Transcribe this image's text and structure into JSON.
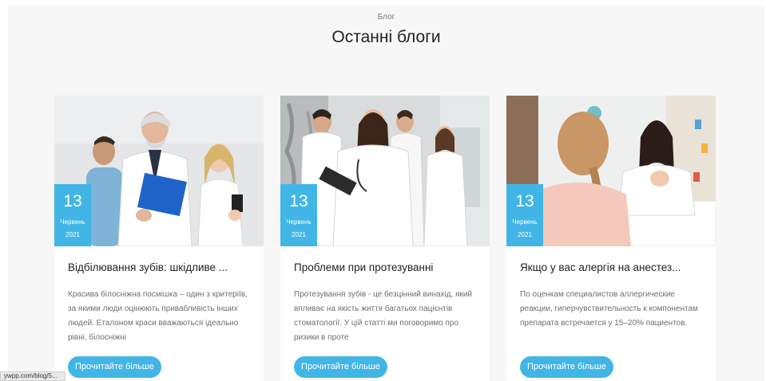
{
  "section": {
    "eyebrow": "Блог",
    "heading": "Останні блоги"
  },
  "posts": [
    {
      "day": "13",
      "month": "Червень",
      "year": "2021",
      "title": "Відбілювання зубів: шкідливе ...",
      "excerpt": "Красива білосніжна посмішка – один з критеріїв, за якими люди оцінюють привабливість інших людей. Еталоном краси вважаються ідеально рівні, білосніжні",
      "button": "Прочитайте більше",
      "image": "doctors-team-photo"
    },
    {
      "day": "13",
      "month": "Червень",
      "year": "2021",
      "title": "Проблеми при протезуванні",
      "excerpt": "Протезування зубів - це безцінний винахід, який впливає на якість життя багатьох пацієнтів стоматології. У цій статті ми поговоримо про ризики в проте",
      "button": "Прочитайте більше",
      "image": "medical-staff-photo"
    },
    {
      "day": "13",
      "month": "Червень",
      "year": "2021",
      "title": "Якщо у вас алергія на анестез...",
      "excerpt": "По оценкам специалистов аллергические реакции, гиперчувствительность к компонентам препарата встречается у 15–20% пациентов.",
      "button": "Прочитайте більше",
      "image": "doctor-consultation-photo"
    }
  ],
  "status_bar": {
    "url": "ywpp.com/blog/5..."
  },
  "colors": {
    "accent": "#41b6e6",
    "section_bg": "#f7f7f7"
  }
}
